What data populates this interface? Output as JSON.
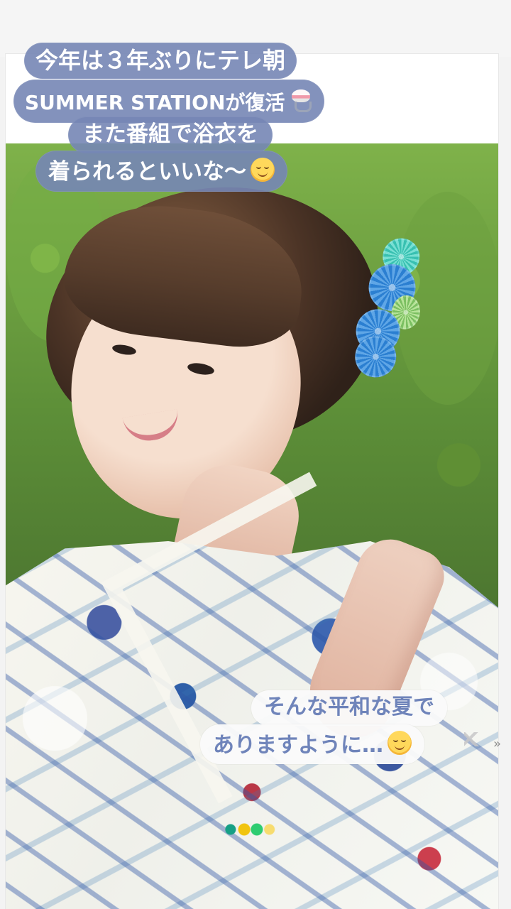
{
  "captions": {
    "top_lines": [
      "今年は３年ぶりにテレ朝",
      "SUMMER STATIONが復活",
      "また番組で浴衣を",
      "着られるといいな〜"
    ],
    "bottom_lines": [
      "そんな平和な夏で",
      "ありますように…"
    ],
    "quote_mark": "»"
  },
  "icons": [
    "shaved-ice-emoji",
    "smiling-face-emoji",
    "relieved-face-emoji",
    "dove-icon"
  ],
  "colors": {
    "caption_blue": "#7586b5",
    "caption_text_blue": "#6f84ba",
    "yukata_blue": "#2f5fa8",
    "yukata_red": "#b93846",
    "hairpin_blue": "#2b7fd1",
    "hairpin_teal": "#38c0b1"
  }
}
